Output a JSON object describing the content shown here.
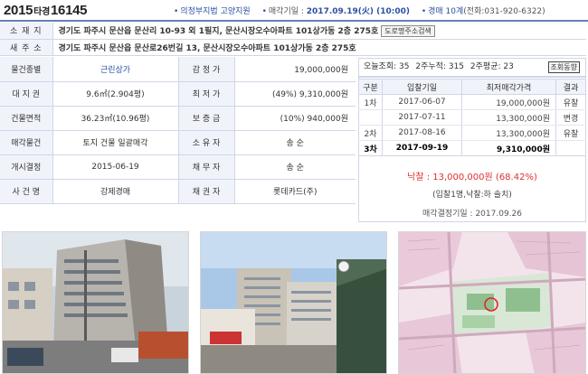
{
  "header": {
    "case_year": "2015",
    "case_type": "타경",
    "case_number": "16145",
    "court": "의정부지법 고양지원",
    "sale_date_label": "매각기일 :",
    "sale_date": "2017.09.19(火) (10:00)",
    "dept": "경매 10계",
    "phone": "(전화:031-920-6322)"
  },
  "address": {
    "location_label": "소 재 지",
    "location": "경기도 파주시 문산읍 문산리 10-93 외 1필지, 문산시장오수아파트 101상가동 2층 275호",
    "road_button": "도로명주소검색",
    "new_address_label": "새 주 소",
    "new_address": "경기도 파주시 문산읍 문산로26번길 13, 문산시장오수아파트 101상가동 2층 275호"
  },
  "info": [
    {
      "label1": "물건종별",
      "value1": "근린상가",
      "label2": "감 정 가",
      "value2": "19,000,000원"
    },
    {
      "label1": "대 지 권",
      "value1": "9.6㎡(2.904평)",
      "label2": "최 저 가",
      "value2": "(49%) 9,310,000원"
    },
    {
      "label1": "건물면적",
      "value1": "36.23㎡(10.96평)",
      "label2": "보 증 금",
      "value2": "(10%) 940,000원"
    },
    {
      "label1": "매각물건",
      "value1": "토지 건물 일괄매각",
      "label2": "소 유 자",
      "value2": "송    순"
    },
    {
      "label1": "개시결정",
      "value1": "2015-06-19",
      "label2": "채 무 자",
      "value2": "송    순"
    },
    {
      "label1": "사 건 명",
      "value1": "강제경매",
      "label2": "채 권 자",
      "value2": "롯데카드(주)"
    }
  ],
  "stats": {
    "today_label": "오늘조회:",
    "today": "35",
    "week_label": "2주누적:",
    "week": "315",
    "avg_label": "2주평균:",
    "avg": "23",
    "button": "조회동향"
  },
  "history": {
    "headers": [
      "구분",
      "입찰기일",
      "최저매각가격",
      "결과"
    ],
    "rows": [
      {
        "round": "1차",
        "date": "2017-06-07",
        "price": "19,000,000원",
        "result": "유찰"
      },
      {
        "round": "",
        "date": "2017-07-11",
        "price": "13,300,000원",
        "result": "변경"
      },
      {
        "round": "2차",
        "date": "2017-08-16",
        "price": "13,300,000원",
        "result": "유찰"
      },
      {
        "round": "3차",
        "date": "2017-09-19",
        "price": "9,310,000원",
        "result": ""
      }
    ]
  },
  "sold": "낙찰 : 13,000,000원",
  "sold_rate": "(68.42%)",
  "bidders": "(입찰1명,낙찰:하      솔치)",
  "decision": "매각결정기일 : 2017.09.26",
  "colors": {
    "blue": "#2b50a3",
    "red": "#e03030",
    "label_bg": "#f1f3fb",
    "border": "#cfd6e6"
  },
  "photos": [
    {
      "icon": "building-street-photo"
    },
    {
      "icon": "building-facade-photo"
    },
    {
      "icon": "cadastral-map-photo"
    }
  ]
}
